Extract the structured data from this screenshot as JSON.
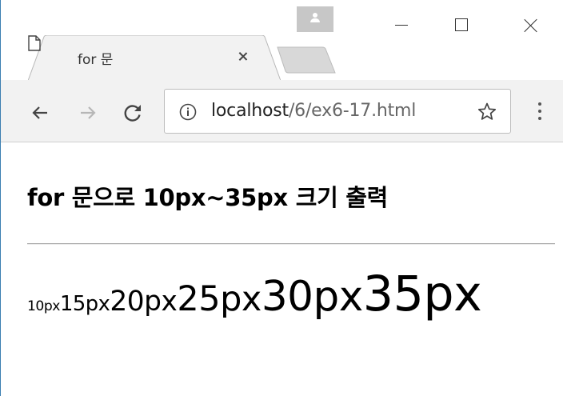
{
  "browser": {
    "tab": {
      "title": "for 문"
    },
    "address_bar": {
      "host": "localhost",
      "path": "/6/ex6-17.html"
    },
    "icons": {
      "back": "arrow-left",
      "forward": "arrow-right",
      "reload": "reload",
      "info": "info-circle",
      "bookmark": "star-outline",
      "menu": "three-dots-vertical",
      "profile": "person",
      "page": "document"
    }
  },
  "page": {
    "heading": "for 문으로 10px~35px 크기 출력",
    "size_items": [
      {
        "text": "10px",
        "font_size": 10
      },
      {
        "text": "15px",
        "font_size": 15
      },
      {
        "text": "20px",
        "font_size": 20
      },
      {
        "text": "25px",
        "font_size": 25
      },
      {
        "text": "30px",
        "font_size": 30
      },
      {
        "text": "35px",
        "font_size": 35
      }
    ]
  }
}
